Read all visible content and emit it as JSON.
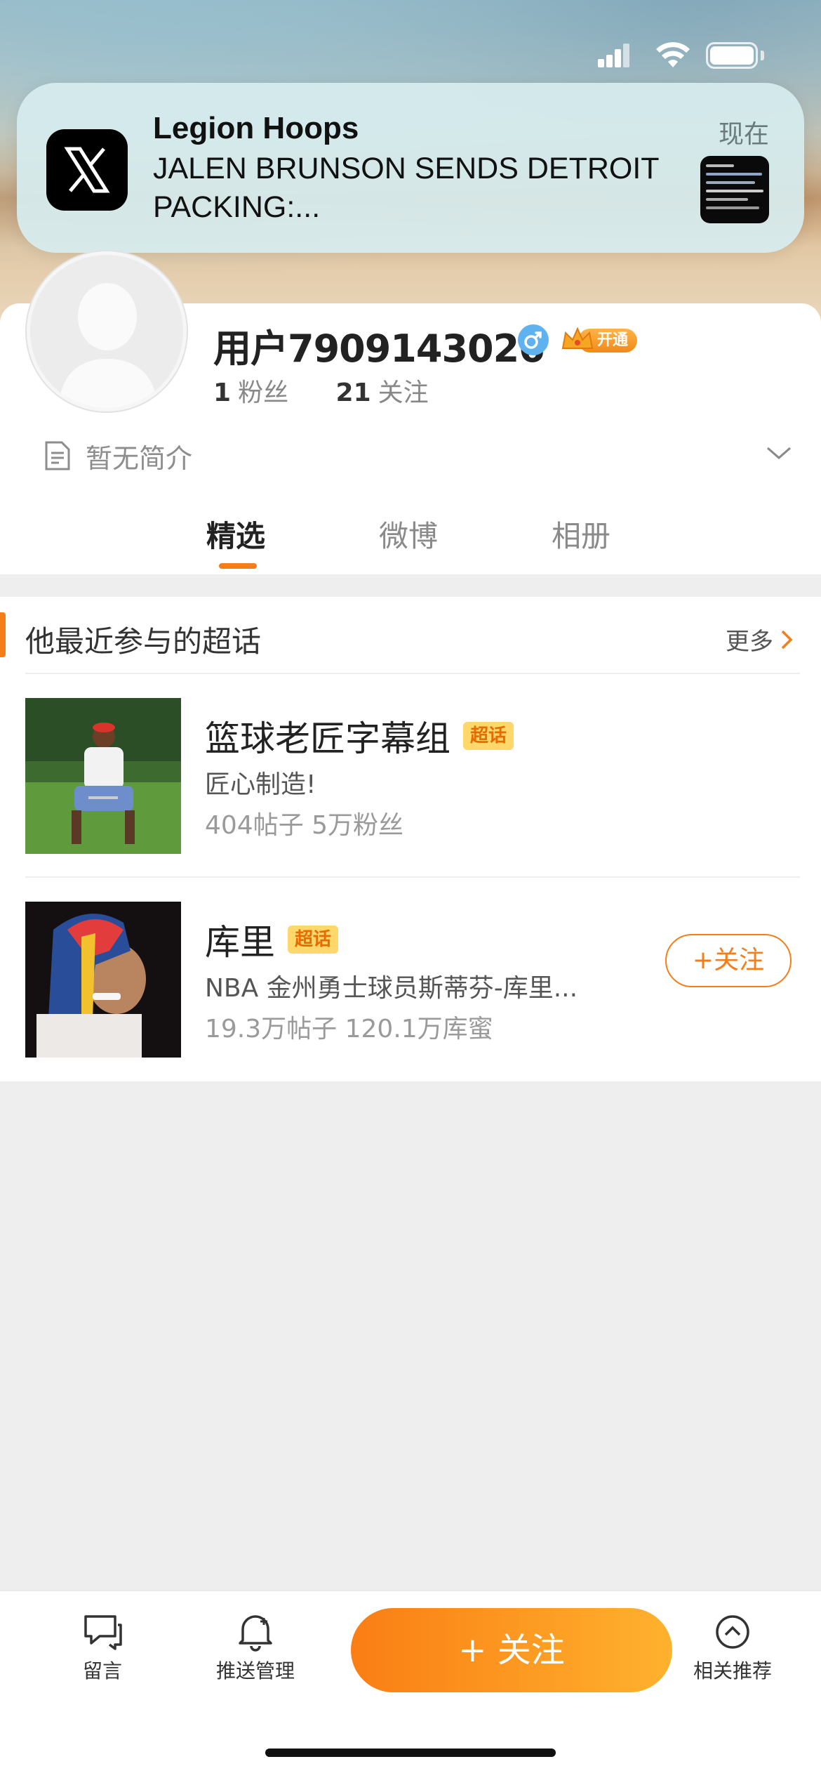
{
  "notification": {
    "app_icon": "x-logo-icon",
    "title": "Legion Hoops",
    "body": "JALEN BRUNSON SENDS DETROIT PACKING:...",
    "time": "现在"
  },
  "profile": {
    "username": "用户7909143026",
    "gender_icon": "male-icon",
    "vip_label": "开通",
    "fans_count": "1",
    "fans_label": "粉丝",
    "following_count": "21",
    "following_label": "关注",
    "bio": "暂无简介"
  },
  "tabs": [
    {
      "label": "精选",
      "active": true
    },
    {
      "label": "微博",
      "active": false
    },
    {
      "label": "相册",
      "active": false
    }
  ],
  "topics_section": {
    "title": "他最近参与的超话",
    "more": "更多",
    "items": [
      {
        "name": "篮球老匠字幕组",
        "tag": "超话",
        "desc": "匠心制造!",
        "meta": "404帖子 5万粉丝",
        "follow_label": ""
      },
      {
        "name": "库里",
        "tag": "超话",
        "desc": "NBA 金州勇士球员斯蒂芬-库里...",
        "meta": "19.3万帖子 120.1万库蜜",
        "follow_label": "+关注"
      }
    ]
  },
  "bottom_bar": {
    "message": "留言",
    "push": "推送管理",
    "follow": "+ 关注",
    "recommend": "相关推荐"
  },
  "colors": {
    "accent": "#f57e19",
    "tag_bg": "#ffd76a",
    "gender_blue": "#5eb2ef"
  }
}
